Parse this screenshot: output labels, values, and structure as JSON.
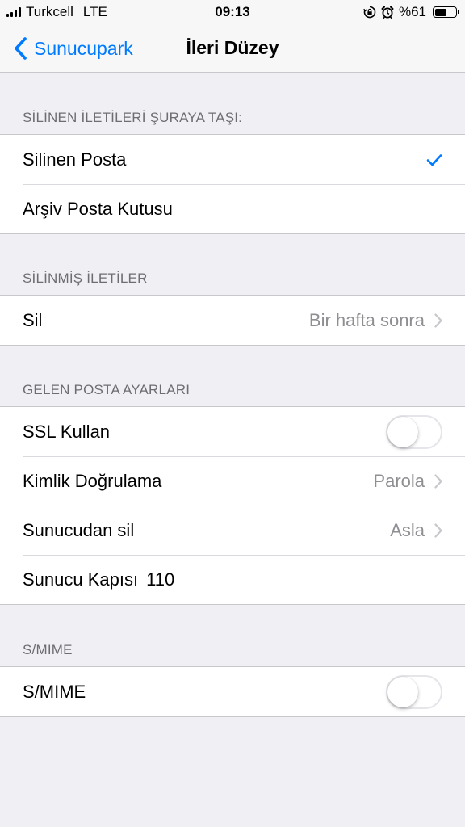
{
  "status_bar": {
    "carrier": "Turkcell",
    "network": "LTE",
    "time": "09:13",
    "battery_text": "%61",
    "battery_level": 0.61
  },
  "nav": {
    "back_label": "Sunucupark",
    "title": "İleri Düzey"
  },
  "sections": {
    "move_deleted": {
      "header": "SİLİNEN İLETİLERİ ŞURAYA TAŞI:",
      "items": [
        {
          "label": "Silinen Posta",
          "checked": true
        },
        {
          "label": "Arşiv Posta Kutusu",
          "checked": false
        }
      ]
    },
    "deleted_messages": {
      "header": "SİLİNMİŞ İLETİLER",
      "items": [
        {
          "label": "Sil",
          "value": "Bir hafta sonra"
        }
      ]
    },
    "incoming": {
      "header": "GELEN POSTA AYARLARI",
      "ssl_label": "SSL Kullan",
      "ssl_on": false,
      "auth_label": "Kimlik Doğrulama",
      "auth_value": "Parola",
      "delete_label": "Sunucudan sil",
      "delete_value": "Asla",
      "port_label": "Sunucu Kapısı",
      "port_value": "110"
    },
    "smime": {
      "header": "S/MIME",
      "label": "S/MIME",
      "on": false
    }
  },
  "colors": {
    "accent": "#007aff",
    "background": "#efeff4",
    "secondary_text": "#8e8e93"
  }
}
